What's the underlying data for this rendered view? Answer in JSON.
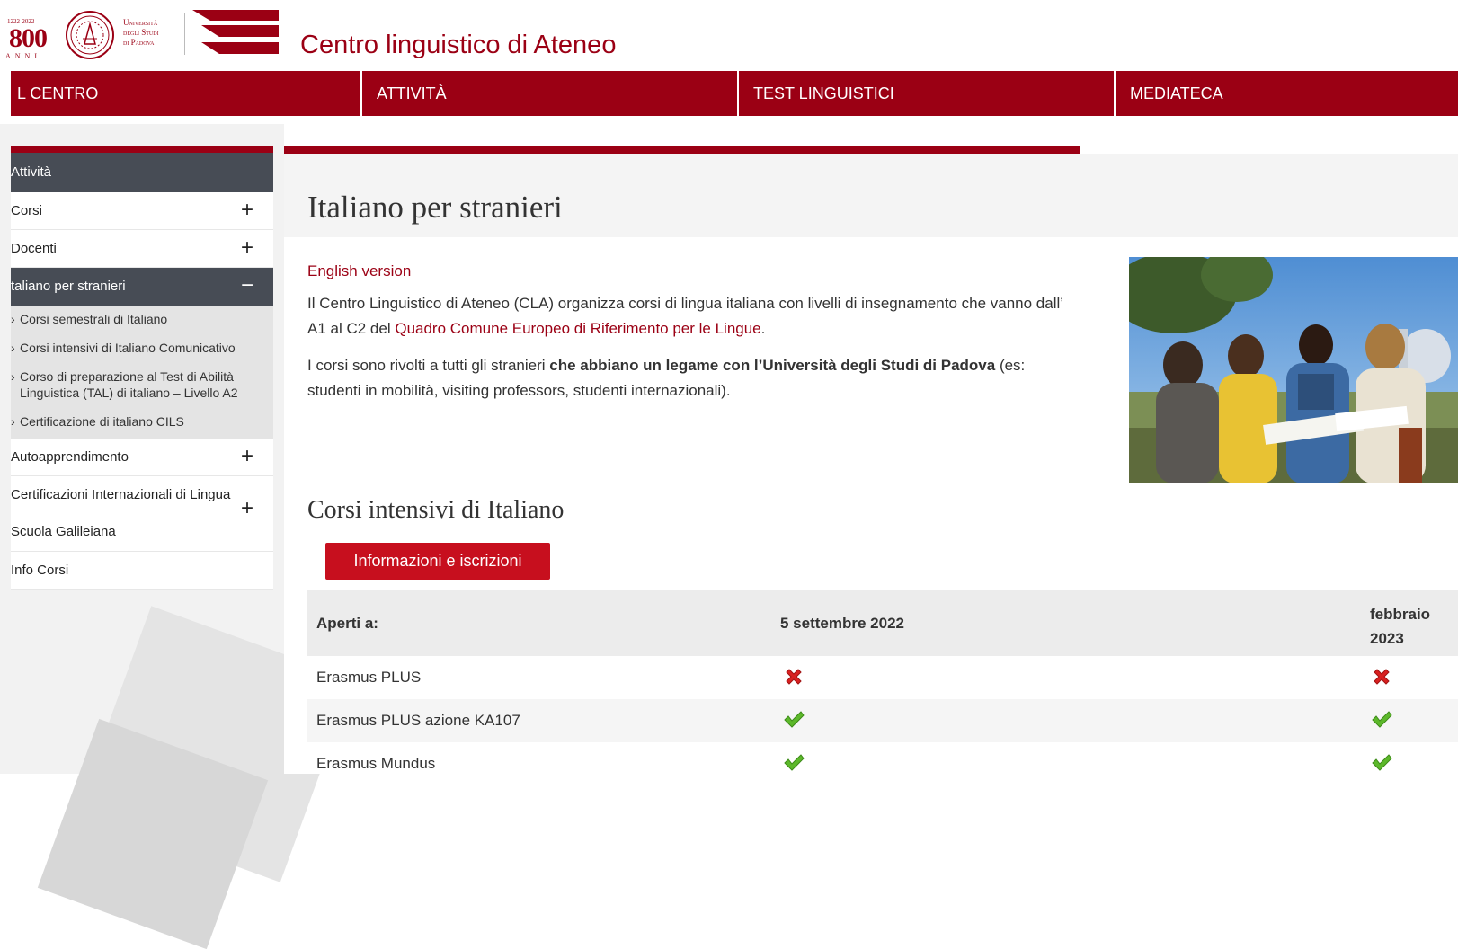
{
  "header": {
    "anniversary_years": "1222-2022",
    "anniversary_number": "800",
    "anniversary_word": "ANNI",
    "university_line1": "Università",
    "university_line2": "degli Studi",
    "university_line3": "di Padova",
    "site_title": "Centro linguistico di Ateneo"
  },
  "nav": {
    "items": [
      {
        "label": "IL CENTRO",
        "visible_label": "L CENTRO"
      },
      {
        "label": "ATTIVITÀ"
      },
      {
        "label": "TEST LINGUISTICI"
      },
      {
        "label": "MEDIATECA"
      }
    ]
  },
  "sidebar": {
    "heading": "Attività",
    "items": [
      {
        "label": "Corsi",
        "visible_label": "Corsi",
        "toggle": "+"
      },
      {
        "label": "Docenti",
        "visible_label": "Docenti",
        "toggle": "+"
      },
      {
        "label": "Italiano per stranieri",
        "visible_label": "taliano per stranieri",
        "toggle": "−"
      }
    ],
    "sub_items": [
      "Corsi semestrali di Italiano",
      "Corsi intensivi di Italiano Comunicativo",
      "Corso di preparazione al Test di Abilità Linguistica (TAL) di italiano – Livello A2",
      "Certificazione di italiano CILS"
    ],
    "items_after": [
      {
        "label": "Autoapprendimento",
        "toggle": "+"
      },
      {
        "label": "Certificazioni Internazionali di Lingua",
        "toggle": "+"
      },
      {
        "label": "Scuola Galileiana",
        "toggle": ""
      },
      {
        "label": "Info Corsi",
        "toggle": ""
      }
    ]
  },
  "main": {
    "page_title": "Italiano per stranieri",
    "english_link": "English version",
    "para1_text": "Il Centro Linguistico di Ateneo (CLA) organizza corsi di lingua italiana con livelli di insegnamento che vanno dall’ A1 al C2 del ",
    "para1_link": "Quadro Comune Europeo di Riferimento per le Lingue",
    "para1_end": ".",
    "para2_start": "I corsi sono rivolti a tutti gli stranieri ",
    "para2_bold": "che abbiano un legame con l’Università degli Studi di Padova",
    "para2_end": " (es: studenti in mobilità, visiting professors, studenti internazionali).",
    "section_title": "Corsi intensivi di Italiano",
    "button_label": "Informazioni e iscrizioni"
  },
  "table": {
    "headers": [
      "Aperti a:",
      "5 settembre 2022",
      "febbraio 2023"
    ],
    "header_col3_line1": "febbraio",
    "header_col3_line2": "2023",
    "rows": [
      {
        "label": "Erasmus PLUS",
        "col2": "cross-icon",
        "col3": "cross-icon"
      },
      {
        "label": "Erasmus PLUS azione KA107",
        "col2": "check-icon",
        "col3": "check-icon"
      },
      {
        "label": "Erasmus Mundus",
        "col2": "check-icon",
        "col3": "check-icon"
      }
    ]
  },
  "colors": {
    "brand_red": "#9b0014",
    "button_red": "#c70f1e",
    "sidebar_dark": "#474c55",
    "check_green": "#5cb82a",
    "cross_red": "#d92020"
  }
}
